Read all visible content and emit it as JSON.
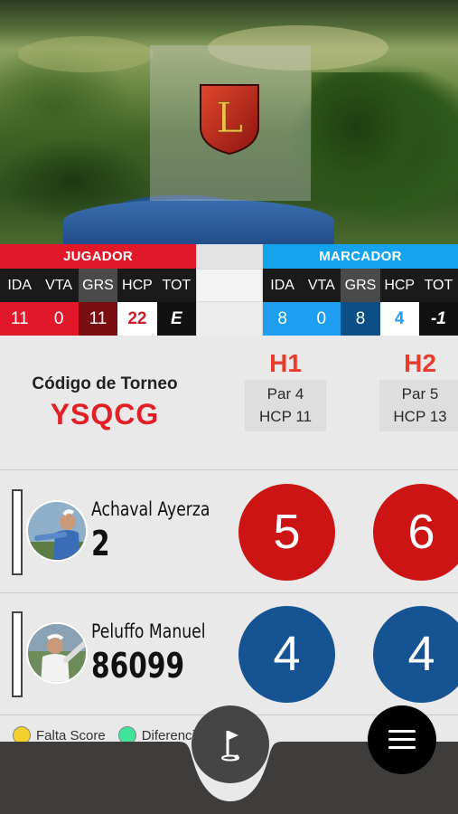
{
  "player_card": {
    "header": "JUGADOR",
    "labels": [
      "IDA",
      "VTA",
      "GRS",
      "HCP",
      "TOT"
    ],
    "values": [
      "11",
      "0",
      "11",
      "22",
      "E"
    ],
    "colors": [
      "#e0182a",
      "#e0182a",
      "#7a0d10",
      "#ffffff",
      "#111111"
    ]
  },
  "marker_card": {
    "header": "MARCADOR",
    "labels": [
      "IDA",
      "VTA",
      "GRS",
      "HCP",
      "TOT"
    ],
    "values": [
      "8",
      "0",
      "8",
      "4",
      "-1"
    ],
    "colors": [
      "#1d9ef0",
      "#1d9ef0",
      "#0c4e86",
      "#ffffff",
      "#111111"
    ]
  },
  "tournament": {
    "label": "Código de Torneo",
    "code": "YSQCG"
  },
  "holes": [
    {
      "number": "H1",
      "par": "Par 4",
      "hcp": "HCP 11"
    },
    {
      "number": "H2",
      "par": "Par 5",
      "hcp": "HCP 13"
    }
  ],
  "players": [
    {
      "name": "Achaval Ayerza",
      "handicap": "2",
      "scores": [
        "5",
        "6"
      ],
      "score_color": "red"
    },
    {
      "name": "Peluffo Manuel",
      "handicap": "86099",
      "scores": [
        "4",
        "4"
      ],
      "score_color": "blue"
    }
  ],
  "legend": [
    {
      "label": "Falta Score",
      "color": "#f2cf2b"
    },
    {
      "label": "Diferencia",
      "color": "#3fe39b"
    }
  ],
  "brand": {
    "logo_letter": "L",
    "accent": "#e21f25"
  },
  "icons": {
    "menu": "hamburger-menu-icon",
    "flag": "golf-flag-icon"
  }
}
